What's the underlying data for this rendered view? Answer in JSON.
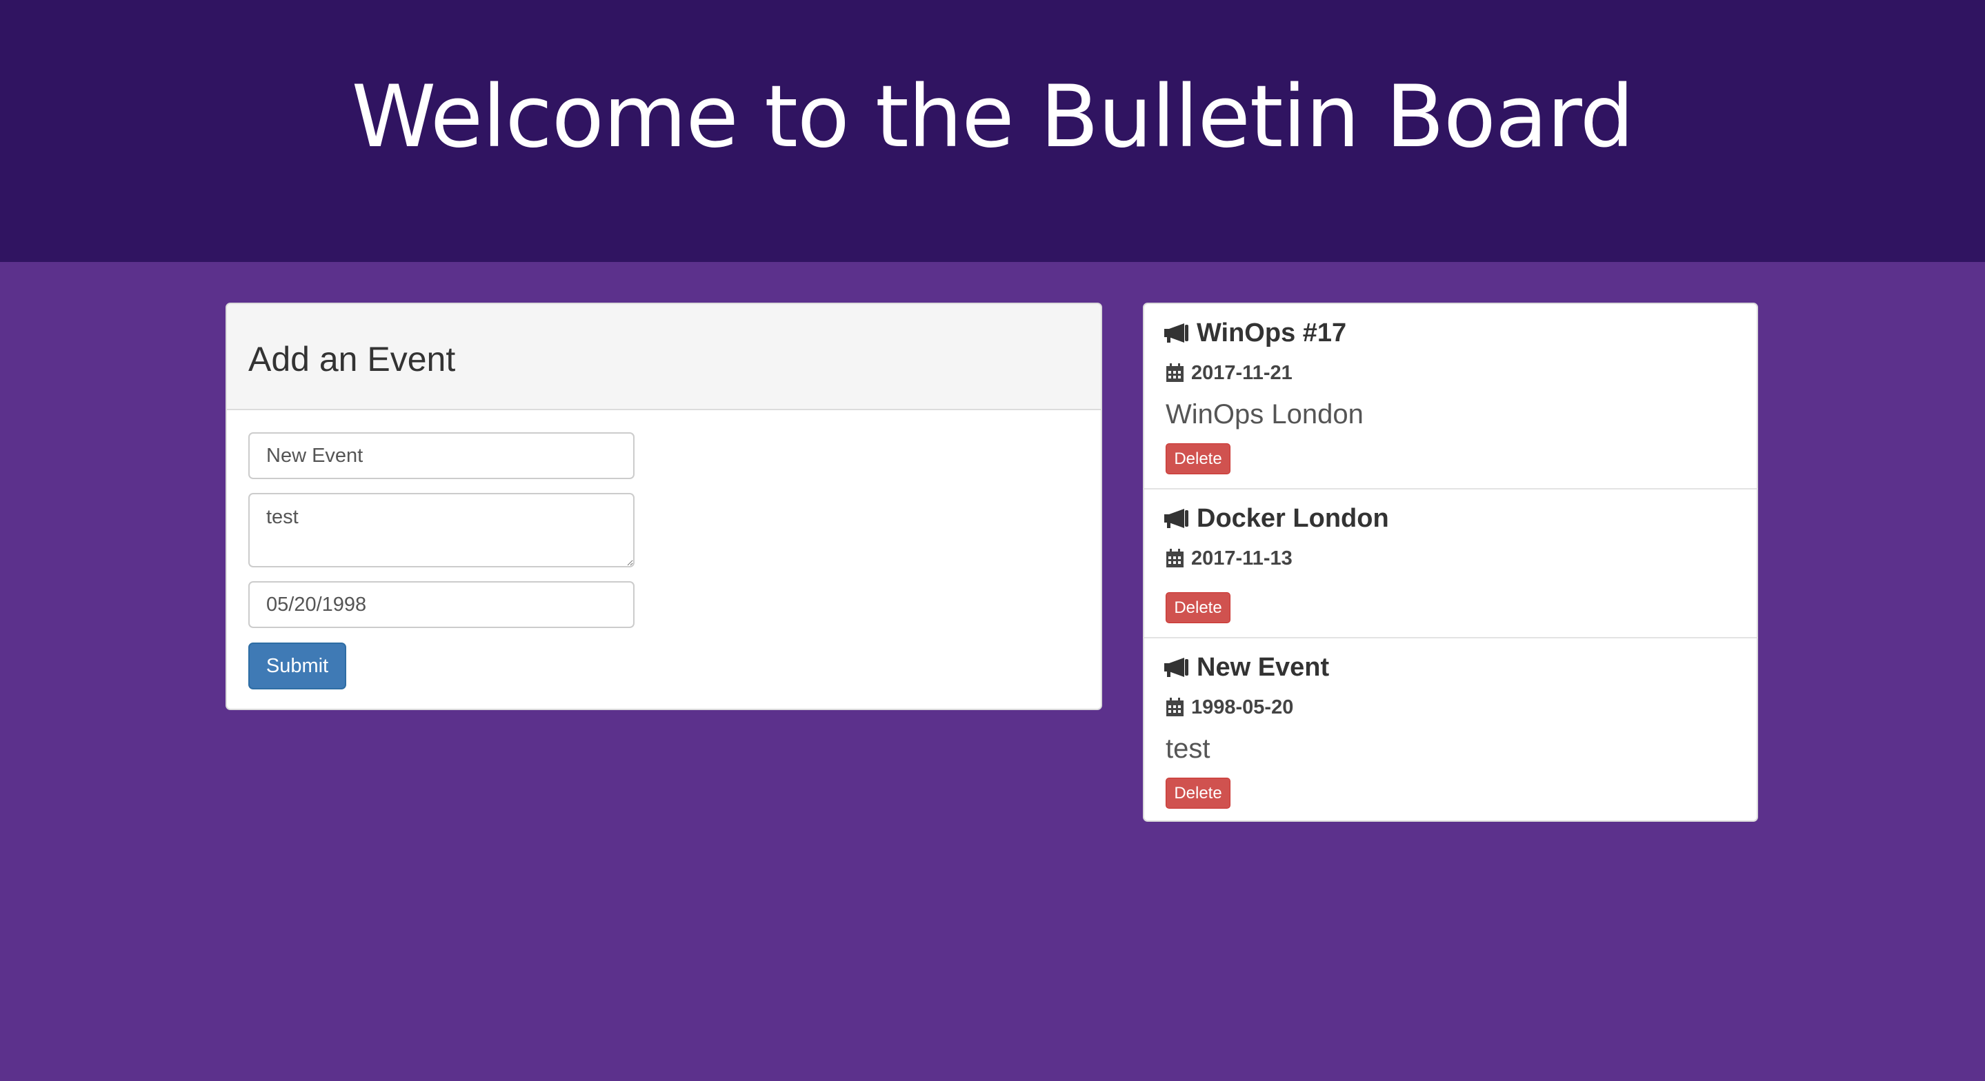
{
  "header": {
    "title": "Welcome to the Bulletin Board"
  },
  "form": {
    "heading": "Add an Event",
    "title_value": "New Event",
    "description_value": "test",
    "date_value": "05/20/1998",
    "submit_label": "Submit"
  },
  "events": [
    {
      "title": "WinOps #17",
      "date": "2017-11-21",
      "description": "WinOps London",
      "delete_label": "Delete"
    },
    {
      "title": "Docker London",
      "date": "2017-11-13",
      "description": "",
      "delete_label": "Delete"
    },
    {
      "title": "New Event",
      "date": "1998-05-20",
      "description": "test",
      "delete_label": "Delete"
    }
  ],
  "icons": {
    "event_title": "megaphone-icon",
    "event_date": "calendar-icon"
  },
  "colors": {
    "header_bg": "#301461",
    "page_bg": "#5c318c",
    "submit_btn": "#3f7ab5",
    "delete_btn": "#d0524f"
  }
}
